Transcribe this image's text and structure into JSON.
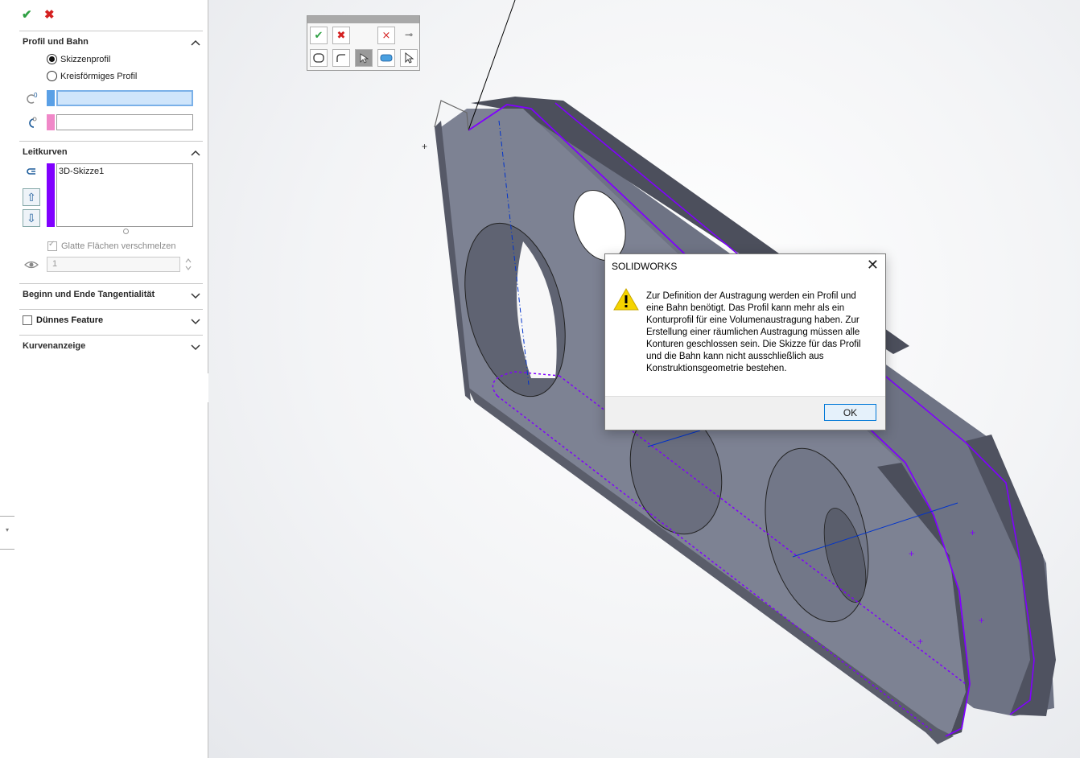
{
  "colors": {
    "accent_blue": "#5aa0e6",
    "guide_purple": "#8000ff",
    "path_pink": "#f088c8",
    "model_gray": "#7b8091",
    "model_dark": "#4a4d5a"
  },
  "property_manager": {
    "ok_icon": "green-check-icon",
    "cancel_icon": "red-x-icon",
    "sections": {
      "profile_path": {
        "title": "Profil und Bahn",
        "options": [
          "Skizzenprofil",
          "Kreisförmiges Profil"
        ],
        "selected": "Skizzenprofil",
        "profile_field": "",
        "path_field": ""
      },
      "guide_curves": {
        "title": "Leitkurven",
        "items": [
          "3D-Skizze1"
        ],
        "merge_smooth_label": "Glatte Flächen verschmelzen",
        "merge_smooth_checked": true,
        "spinner_value": "1"
      },
      "tangency": {
        "title": "Beginn und Ende Tangentialität"
      },
      "thin_feature": {
        "title": "Dünnes Feature",
        "checked": false
      },
      "curve_display": {
        "title": "Kurvenanzeige"
      }
    }
  },
  "dialog": {
    "title": "SOLIDWORKS",
    "icon": "warning-icon",
    "message": "Zur Definition der Austragung werden ein Profil und eine Bahn benötigt. Das Profil kann mehr als ein Konturprofil für eine Volumenaustragung haben. Zur Erstellung einer räumlichen Austragung müssen alle Konturen geschlossen sein. Die Skizze für das Profil und die Bahn kann nicht ausschließlich aus Konstruktionsgeometrie bestehen.",
    "ok_label": "OK"
  }
}
